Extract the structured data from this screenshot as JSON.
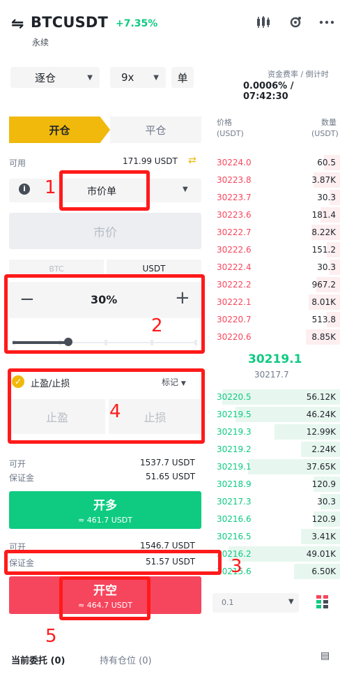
{
  "header": {
    "swap_icon": "⇋",
    "symbol": "BTCUSDT",
    "change": "+7.35%",
    "contract_type": "永续",
    "icons": [
      "candlestick-icon",
      "settings-icon",
      "more-icon"
    ]
  },
  "controls": {
    "margin_mode": "逐仓",
    "leverage": "9x",
    "single_label": "单",
    "funding_label": "资金费率 / 倒计时",
    "funding_value": "0.0006% / 07:42:30"
  },
  "tabs": {
    "open": "开仓",
    "close": "平仓"
  },
  "form": {
    "available_label": "可用",
    "available_value": "171.99 USDT",
    "order_type": "市价单",
    "price_placeholder": "市价",
    "unit_btc": "BTC",
    "unit_usdt": "USDT",
    "quantity": "30%",
    "slider_percent": 30,
    "tpsl_label": "止盈/止损",
    "tpsl_mark": "标记",
    "tp_placeholder": "止盈",
    "sl_placeholder": "止损",
    "long_open_label": "可开",
    "long_open_value": "1537.7 USDT",
    "long_margin_label": "保证金",
    "long_margin_value": "51.65 USDT",
    "long_button": "开多",
    "long_button_sub": "≈ 461.7 USDT",
    "short_open_label": "可开",
    "short_open_value": "1546.7 USDT",
    "short_margin_label": "保证金",
    "short_margin_value": "51.57 USDT",
    "short_button": "开空",
    "short_button_sub": "≈ 464.7 USDT"
  },
  "bottom_tabs": {
    "positions": "当前委托 (0)",
    "history": "持有仓位 (0)"
  },
  "orderbook": {
    "price_header_1": "价格",
    "price_header_2": "(USDT)",
    "qty_header_1": "数量",
    "qty_header_2": "(USDT)",
    "asks": [
      {
        "price": "30224.0",
        "qty": "60.5",
        "depth": 0.12
      },
      {
        "price": "30223.8",
        "qty": "3.87K",
        "depth": 0.2
      },
      {
        "price": "30223.7",
        "qty": "30.3",
        "depth": 0.08
      },
      {
        "price": "30223.6",
        "qty": "181.4",
        "depth": 0.15
      },
      {
        "price": "30222.7",
        "qty": "8.22K",
        "depth": 0.22
      },
      {
        "price": "30222.6",
        "qty": "151.2",
        "depth": 0.1
      },
      {
        "price": "30222.4",
        "qty": "30.3",
        "depth": 0.08
      },
      {
        "price": "30222.2",
        "qty": "967.2",
        "depth": 0.18
      },
      {
        "price": "30222.1",
        "qty": "8.01K",
        "depth": 0.24
      },
      {
        "price": "30220.7",
        "qty": "513.8",
        "depth": 0.1
      },
      {
        "price": "30220.6",
        "qty": "8.85K",
        "depth": 0.26
      }
    ],
    "mid_price": "30219.1",
    "mark_price": "30217.7",
    "bids": [
      {
        "price": "30220.5",
        "qty": "56.12K",
        "depth": 0.9
      },
      {
        "price": "30219.5",
        "qty": "46.24K",
        "depth": 0.8
      },
      {
        "price": "30219.3",
        "qty": "12.99K",
        "depth": 0.5
      },
      {
        "price": "30219.2",
        "qty": "2.24K",
        "depth": 0.3
      },
      {
        "price": "30219.1",
        "qty": "37.65K",
        "depth": 0.7
      },
      {
        "price": "30218.9",
        "qty": "120.9",
        "depth": 0.2
      },
      {
        "price": "30217.3",
        "qty": "30.3",
        "depth": 0.15
      },
      {
        "price": "30216.6",
        "qty": "120.9",
        "depth": 0.2
      },
      {
        "price": "30216.5",
        "qty": "3.41K",
        "depth": 0.3
      },
      {
        "price": "30216.2",
        "qty": "49.01K",
        "depth": 0.85
      },
      {
        "price": "30215.6",
        "qty": "6.50K",
        "depth": 0.35
      }
    ],
    "depth_value": "0.1"
  },
  "annotations": [
    "1",
    "2",
    "3",
    "4",
    "5"
  ],
  "colors": {
    "accent": "#f0b90b",
    "buy": "#0ecb81",
    "sell": "#f6465d",
    "annotation": "#ff1a1a"
  }
}
